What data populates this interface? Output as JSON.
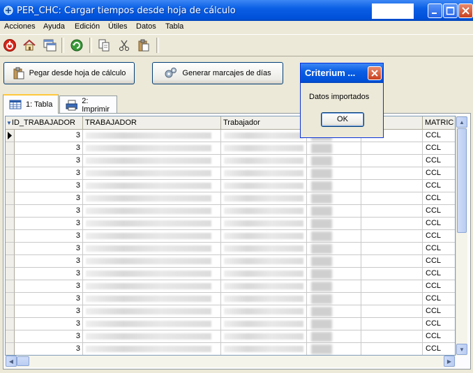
{
  "window": {
    "title": "PER_CHC: Cargar tiempos desde hoja de cálculo"
  },
  "menu": [
    "Acciones",
    "Ayuda",
    "Edición",
    "Útiles",
    "Datos",
    "Tabla"
  ],
  "toolbar_icons": [
    "stop-icon",
    "home-icon",
    "windows-icon",
    "refresh-icon",
    "copy-icon",
    "cut-icon",
    "paste-icon"
  ],
  "actions": {
    "paste_label": "Pegar desde hoja de cálculo",
    "generate_label": "Generar marcajes de días"
  },
  "tabs": [
    {
      "label": "1: Tabla",
      "active": true
    },
    {
      "label": "2: Imprimir",
      "active": false
    }
  ],
  "grid": {
    "columns": [
      "ID_TRABAJADOR",
      "TRABAJADOR",
      "Trabajador",
      "",
      "",
      "MATRIC"
    ],
    "rows": [
      {
        "id": "3",
        "matric": "CCL"
      },
      {
        "id": "3",
        "matric": "CCL"
      },
      {
        "id": "3",
        "matric": "CCL"
      },
      {
        "id": "3",
        "matric": "CCL"
      },
      {
        "id": "3",
        "matric": "CCL"
      },
      {
        "id": "3",
        "matric": "CCL"
      },
      {
        "id": "3",
        "matric": "CCL"
      },
      {
        "id": "3",
        "matric": "CCL"
      },
      {
        "id": "3",
        "matric": "CCL"
      },
      {
        "id": "3",
        "matric": "CCL"
      },
      {
        "id": "3",
        "matric": "CCL"
      },
      {
        "id": "3",
        "matric": "CCL"
      },
      {
        "id": "3",
        "matric": "CCL"
      },
      {
        "id": "3",
        "matric": "CCL"
      },
      {
        "id": "3",
        "matric": "CCL"
      },
      {
        "id": "3",
        "matric": "CCL"
      },
      {
        "id": "3",
        "matric": "CCL"
      },
      {
        "id": "3",
        "matric": "CCL"
      }
    ]
  },
  "dialog": {
    "title": "Criterium ...",
    "message": "Datos importados",
    "ok_label": "OK"
  }
}
